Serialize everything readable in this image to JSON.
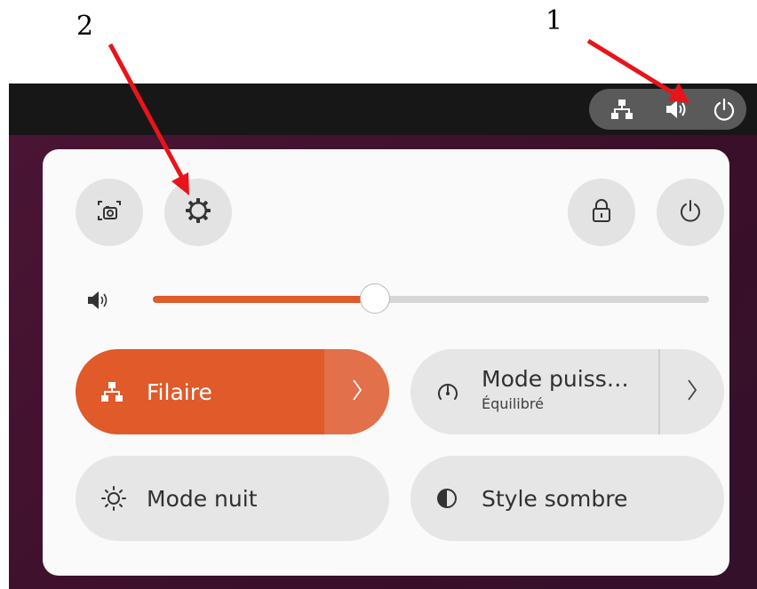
{
  "annotations": {
    "label_1": "1",
    "label_2": "2"
  },
  "colors": {
    "accent": "#e05a2a",
    "accent_dark": "#c5421a",
    "arrow": "#e8141a",
    "topbar": "#171717",
    "tile": "#e6e6e6"
  },
  "tray": {
    "icons": [
      "network-wired-icon",
      "speaker-icon",
      "power-icon"
    ]
  },
  "quick_settings": {
    "volume_percent": 40,
    "tiles": {
      "wired": {
        "label": "Filaire",
        "active": true
      },
      "power_mode": {
        "label": "Mode puiss…",
        "sublabel": "Équilibré"
      },
      "night_mode": {
        "label": "Mode nuit"
      },
      "dark_style": {
        "label": "Style sombre"
      }
    }
  }
}
